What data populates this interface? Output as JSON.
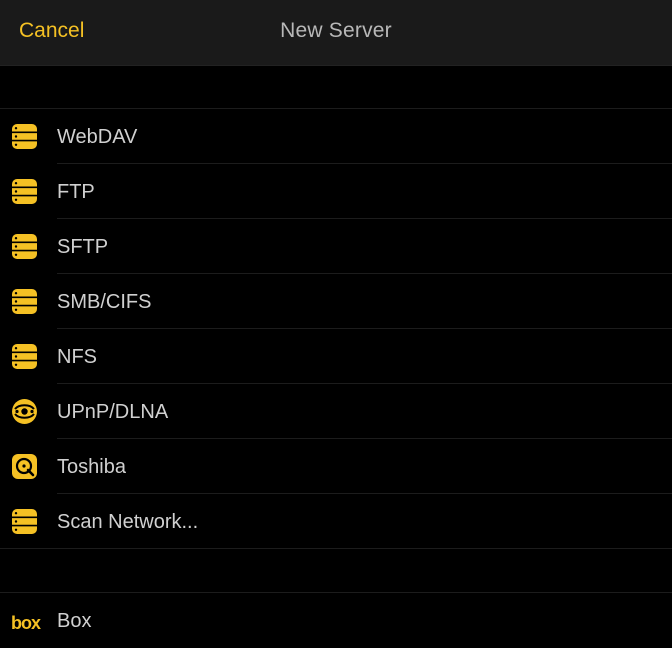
{
  "header": {
    "cancel_label": "Cancel",
    "title": "New Server"
  },
  "colors": {
    "accent": "#f5c124",
    "background": "#000000",
    "nav_background": "#1a1a1a"
  },
  "servers": [
    {
      "label": "WebDAV",
      "icon": "server-stack-icon"
    },
    {
      "label": "FTP",
      "icon": "server-stack-icon"
    },
    {
      "label": "SFTP",
      "icon": "server-stack-icon"
    },
    {
      "label": "SMB/CIFS",
      "icon": "server-stack-icon"
    },
    {
      "label": "NFS",
      "icon": "server-stack-icon"
    },
    {
      "label": "UPnP/DLNA",
      "icon": "upnp-network-icon"
    },
    {
      "label": "Toshiba",
      "icon": "toshiba-drive-icon"
    },
    {
      "label": "Scan Network...",
      "icon": "server-stack-icon"
    }
  ],
  "cloud": [
    {
      "label": "Box",
      "icon": "box-logo-icon",
      "logo_text": "box"
    }
  ]
}
